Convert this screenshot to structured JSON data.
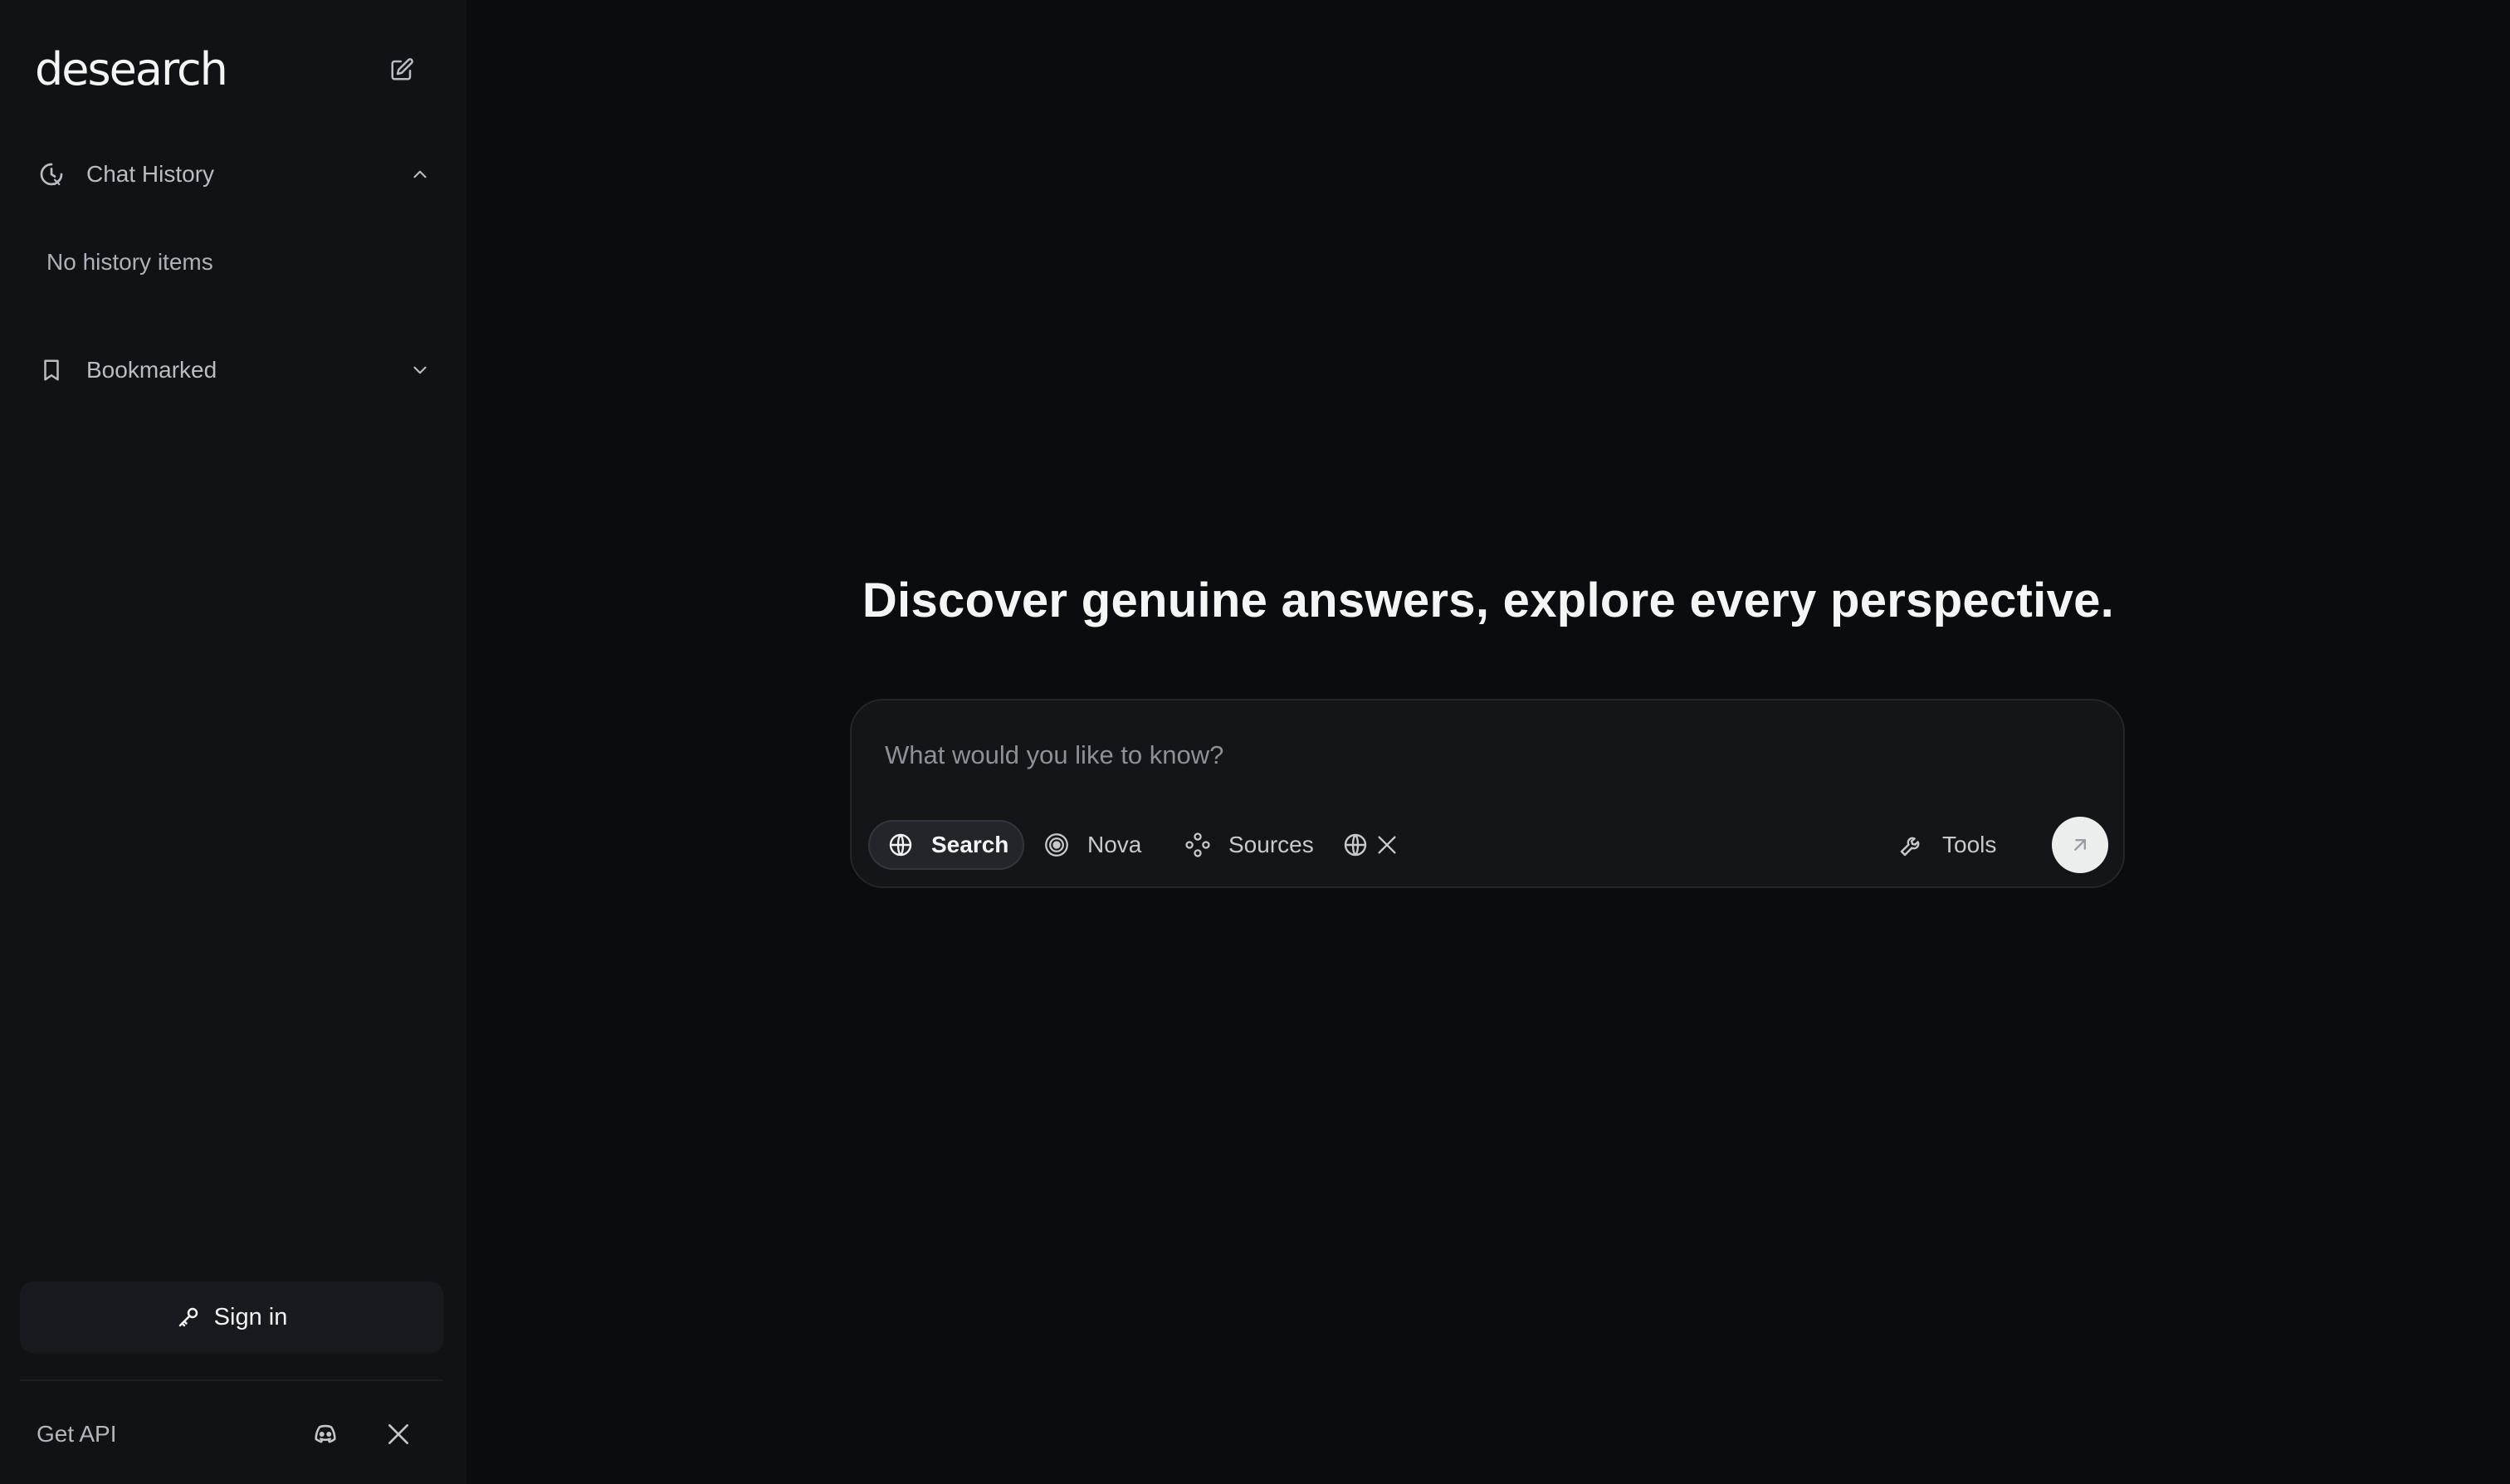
{
  "app": {
    "name": "desearch"
  },
  "sidebar": {
    "logo": "desearch",
    "new_chat_icon": "edit-icon",
    "chat_history": {
      "label": "Chat History",
      "expanded": true,
      "empty_text": "No history items"
    },
    "bookmarked": {
      "label": "Bookmarked",
      "expanded": false
    },
    "sign_in_label": "Sign in",
    "footer": {
      "api_label": "Get API",
      "icons": [
        "discord-icon",
        "x-icon"
      ]
    }
  },
  "main": {
    "headline": "Discover genuine answers, explore every perspective.",
    "composer": {
      "placeholder": "What would you like to know?",
      "modes": [
        {
          "label": "Search",
          "icon": "globe-icon",
          "selected": true
        },
        {
          "label": "Nova",
          "icon": "radar-icon",
          "selected": false
        },
        {
          "label": "Sources",
          "icon": "nodes-icon",
          "selected": false
        }
      ],
      "source_icons": [
        "globe-icon",
        "x-icon"
      ],
      "tools_label": "Tools",
      "send_icon": "arrow-up-right-icon"
    }
  },
  "colors": {
    "background": "#0b0c0f",
    "sidebar": "#111216",
    "composer": "#141519",
    "send_button": "#eceded"
  }
}
